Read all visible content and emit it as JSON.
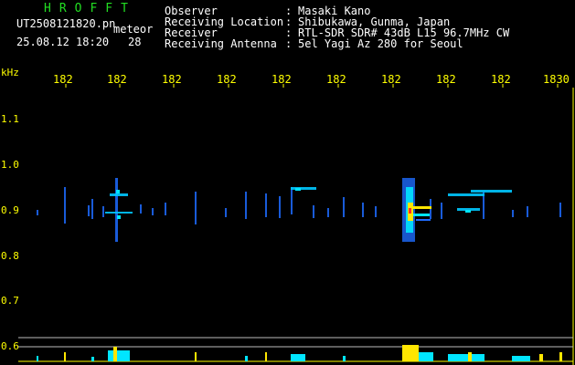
{
  "header": {
    "logo": "HROFFT",
    "filename": "UT2508121820.pn",
    "event_type": "meteor",
    "timestamp": "25.08.12 18:20",
    "count": "28",
    "fields": [
      {
        "label": "Observer",
        "value": "Masaki Kano"
      },
      {
        "label": "Receiving Location",
        "value": "Shibukawa, Gunma, Japan"
      },
      {
        "label": "Receiver",
        "value": "RTL-SDR SDR# 43dB L15 96.7MHz CW"
      },
      {
        "label": "Receiving Antenna",
        "value": "5el Yagi Az 280 for Seoul"
      }
    ]
  },
  "axis": {
    "unit": "kHz",
    "y_ticks": [
      "1.1",
      "1.0",
      "0.9",
      "0.8",
      "0.7",
      "0.6"
    ],
    "x_ticks": [
      "182",
      "182",
      "182",
      "182",
      "182",
      "182",
      "182",
      "182",
      "182",
      "1830"
    ]
  },
  "colors": {
    "text": "#ffffff",
    "axis": "#ffff00",
    "logo": "#22dd22",
    "echo_blue": "#1e6bff",
    "echo_cyan": "#00e5ff",
    "echo_yellow": "#ffe600",
    "echo_red": "#ff2a2a"
  }
}
